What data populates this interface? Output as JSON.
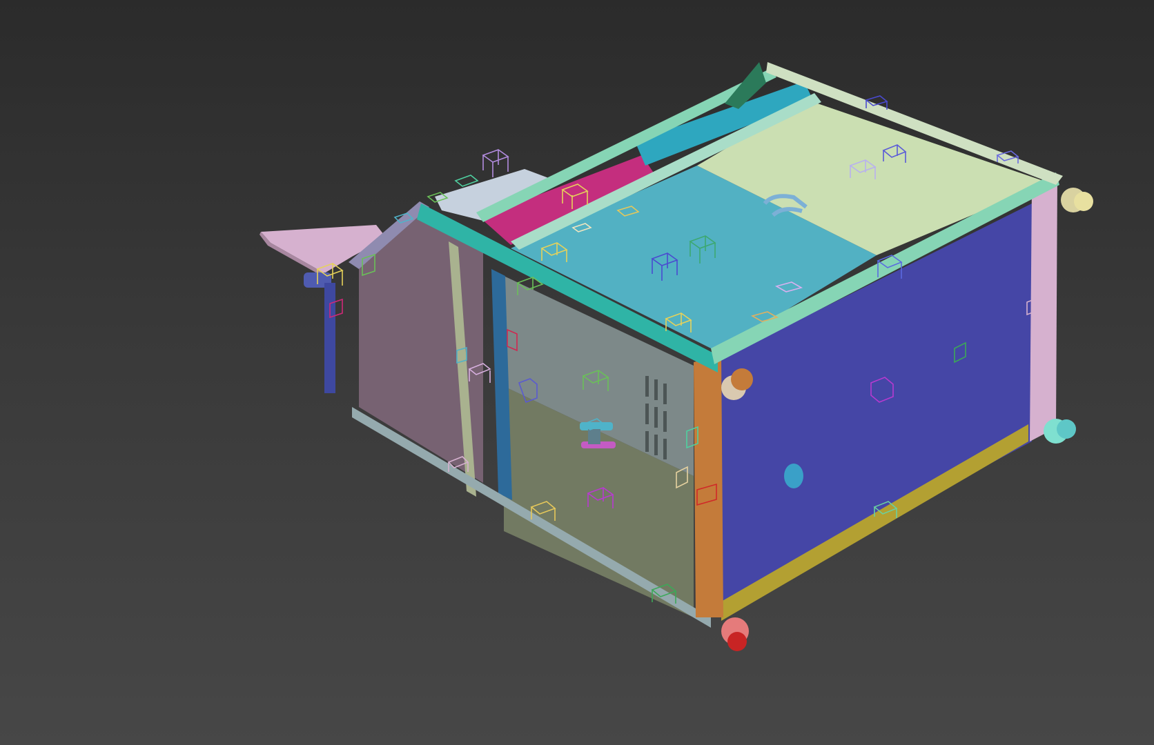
{
  "viewport": {
    "kind": "3d-perspective-viewport",
    "background_top": "#2b2b2b",
    "background_bottom": "#474747"
  },
  "model": {
    "colors": {
      "lid_cyan": "#52b1c3",
      "lid_cream": "#cbdfb2",
      "rail_mint": "#86d5b5",
      "rail_teal": "#2fb4a6",
      "roller_cyan": "#2ea7bf",
      "strip_magenta": "#c42e7e",
      "side_blue": "#4546a6",
      "front_sage": "#727a62",
      "front_gray": "#7d8989",
      "hopper_mauve": "#776272",
      "shelf_pink": "#d6b1cf",
      "post_orange": "#c47b3a",
      "base_gold": "#b3a032",
      "caster_red": "#d23a3a",
      "caster_teal": "#5ec7c7"
    },
    "icons": [
      "helper-gizmo-icon",
      "caster-wheel-icon",
      "handle-icon",
      "vent-slot-icon"
    ]
  }
}
